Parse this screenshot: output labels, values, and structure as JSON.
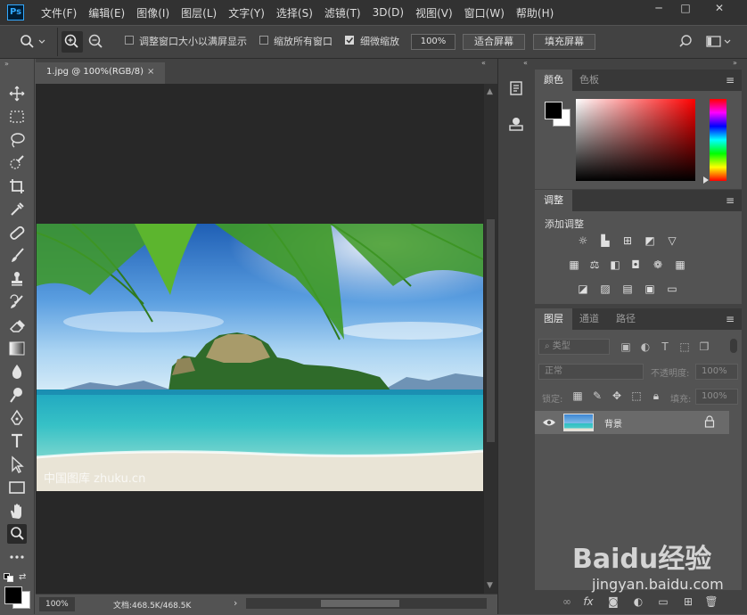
{
  "app": {
    "logo": "Ps"
  },
  "menu": [
    "文件(F)",
    "编辑(E)",
    "图像(I)",
    "图层(L)",
    "文字(Y)",
    "选择(S)",
    "滤镜(T)",
    "3D(D)",
    "视图(V)",
    "窗口(W)",
    "帮助(H)"
  ],
  "window_controls": {
    "minimize": "─",
    "maximize": "□",
    "close": "✕"
  },
  "options": {
    "resize_windows_label": "调整窗口大小以满屏显示",
    "zoom_all_label": "缩放所有窗口",
    "scrubby_zoom_label": "细微缩放",
    "scrubby_zoom_checked": true,
    "zoom_value": "100%",
    "fit_screen": "适合屏幕",
    "fill_screen": "填充屏幕"
  },
  "document": {
    "tab_title": "1.jpg @ 100%(RGB/8)",
    "tab_close": "×",
    "photo_watermark": "中国图库 zhuku.cn",
    "zoom_status": "100%",
    "doc_size": "文档:468.5K/468.5K",
    "status_arrow": "›"
  },
  "color_panel": {
    "tabs": [
      "颜色",
      "色板"
    ],
    "foreground": "#000000",
    "background": "#ffffff",
    "hue": "#ff0000"
  },
  "adjustments_panel": {
    "tabs": [
      "调整"
    ],
    "add_label": "添加调整",
    "icons": [
      "brightness-icon",
      "levels-icon",
      "curves-icon",
      "exposure-icon",
      "vibrance-icon",
      "hue-saturation-icon",
      "color-balance-icon",
      "black-white-icon",
      "photo-filter-icon",
      "channel-mixer-icon",
      "color-lookup-icon",
      "invert-icon",
      "posterize-icon",
      "threshold-icon",
      "selective-color-icon",
      "gradient-map-icon"
    ]
  },
  "layers_panel": {
    "tabs": [
      "图层",
      "通道",
      "路径"
    ],
    "filter_kind": "类型",
    "blend_mode": "正常",
    "opacity_label": "不透明度:",
    "opacity_value": "100%",
    "lock_label": "锁定:",
    "fill_label": "填充:",
    "fill_value": "100%",
    "layers": [
      {
        "name": "背景",
        "visible": true,
        "locked": true
      }
    ],
    "footer_icons": [
      "link-icon",
      "fx-icon",
      "mask-icon",
      "adjustment-icon",
      "group-icon",
      "new-layer-icon",
      "trash-icon"
    ]
  },
  "page_watermark": {
    "brand": "Baidu经验",
    "url": "jingyan.baidu.com"
  }
}
